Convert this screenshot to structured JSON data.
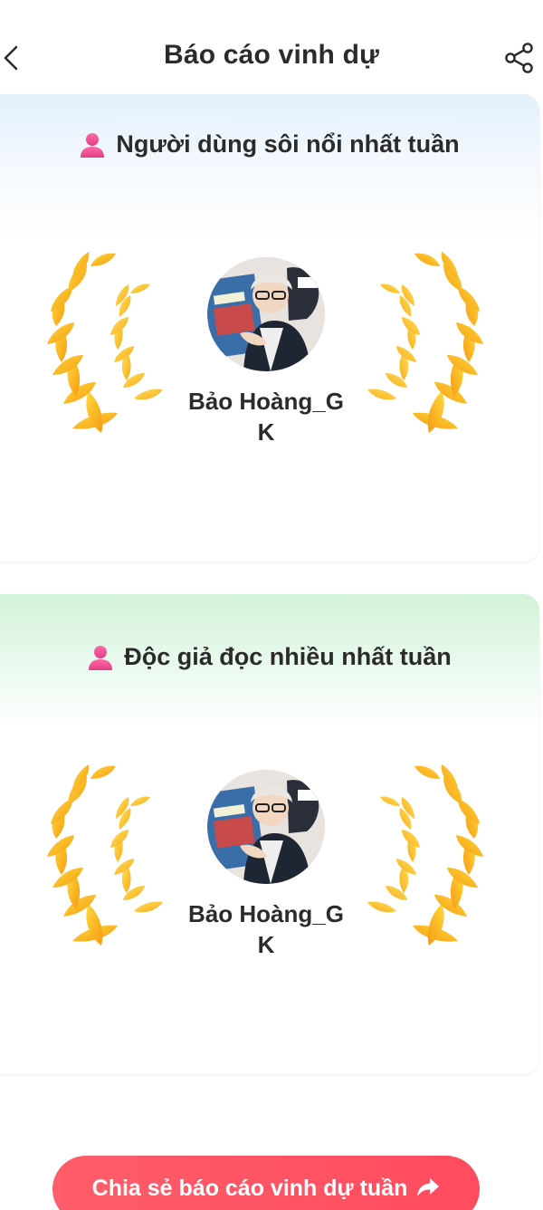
{
  "header": {
    "title": "Báo cáo vinh dự",
    "back_icon": "chevron-left-icon",
    "share_icon": "share-icon"
  },
  "cards": [
    {
      "heading": "Người dùng sôi nổi nhất tuần",
      "user_name": "Bảo Hoàng_GK",
      "accent": "#e3f0fc"
    },
    {
      "heading": "Độc giả đọc nhiều nhất tuần",
      "user_name": "Bảo Hoàng_GK",
      "accent": "#d3f3d9"
    }
  ],
  "share_button": {
    "label": "Chia sẻ báo cáo vinh dự tuần",
    "color": "#ff4b5e",
    "icon": "share-arrow-icon"
  },
  "colors": {
    "laurel_light": "#ffd23a",
    "laurel_dark": "#f79a12",
    "person_icon": "#f0569a"
  }
}
